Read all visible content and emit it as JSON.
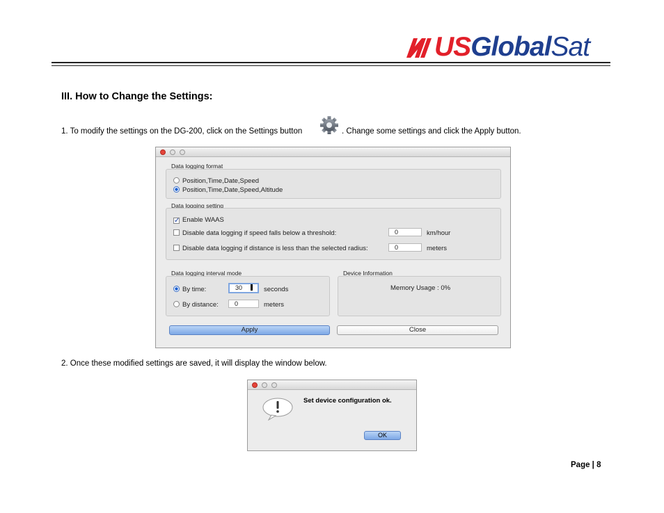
{
  "header": {
    "logo_us": "US",
    "logo_global": "Global",
    "logo_sat": "Sat"
  },
  "section_heading": "III. How to Change the Settings:",
  "step1": {
    "text_before": "1. To modify the settings on the DG-200, click on the Settings button",
    "icon": "gear-icon",
    "text_after": ". Change some settings and click the Apply button."
  },
  "settings_dialog": {
    "logging_format_label": "Data logging format",
    "format_options": [
      {
        "label": "Position,Time,Date,Speed",
        "selected": false
      },
      {
        "label": "Position,Time,Date,Speed,Altitude",
        "selected": true
      }
    ],
    "logging_setting_label": "Data logging setting",
    "enable_waas_label": "Enable WAAS",
    "speed_threshold_label": "Disable data logging if speed falls below a threshold:",
    "speed_threshold_value": "0",
    "speed_unit": "km/hour",
    "radius_label": "Disable data logging if distance is less than the selected radius:",
    "radius_value": "0",
    "radius_unit": "meters",
    "interval_mode_label": "Data logging interval mode",
    "by_time_label": "By time:",
    "by_time_value": "30",
    "by_time_unit": "seconds",
    "by_distance_label": "By distance:",
    "by_distance_value": "0",
    "by_distance_unit": "meters",
    "device_info_label": "Device Information",
    "memory_usage": "Memory Usage :  0%",
    "apply_label": "Apply",
    "close_label": "Close"
  },
  "step2": {
    "text": "2. Once these modified settings are saved, it will display the window below."
  },
  "confirm_dialog": {
    "message": "Set device configuration ok.",
    "ok_label": "OK"
  },
  "page_number": "Page | 8",
  "colors": {
    "logo_red": "#e2202a",
    "logo_blue": "#1f3f8f",
    "apply_blue": "#7ea8e6"
  }
}
